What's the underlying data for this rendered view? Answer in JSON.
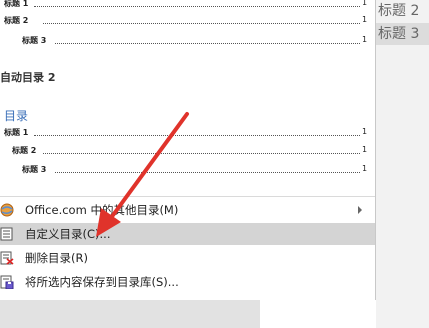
{
  "styles_panel": {
    "heading2": "标题 2",
    "heading3": "标题 3"
  },
  "toc_preview_top": {
    "rows": [
      {
        "label": "标题 1",
        "page": "1"
      },
      {
        "label": "标题 2",
        "page": "1"
      },
      {
        "label": "标题 3",
        "page": "1"
      }
    ]
  },
  "auto_toc2": {
    "section_label": "自动目录 2",
    "toc_title": "目录",
    "rows": [
      {
        "label": "标题 1",
        "page": "1"
      },
      {
        "label": "标题 2",
        "page": "1"
      },
      {
        "label": "标题 3",
        "page": "1"
      }
    ]
  },
  "menu": {
    "items": [
      {
        "label": "Office.com 中的其他目录(M)",
        "icon": "office-globe-icon",
        "submenu": true
      },
      {
        "label": "自定义目录(C)...",
        "icon": "custom-toc-icon",
        "highlighted": true
      },
      {
        "label": "删除目录(R)",
        "icon": "delete-toc-icon"
      },
      {
        "label": "将所选内容保存到目录库(S)...",
        "icon": "save-to-gallery-icon"
      }
    ]
  },
  "colors": {
    "arrow": "#e0332b",
    "toc_title": "#3a6fb8",
    "highlight": "#d4d4d4"
  }
}
